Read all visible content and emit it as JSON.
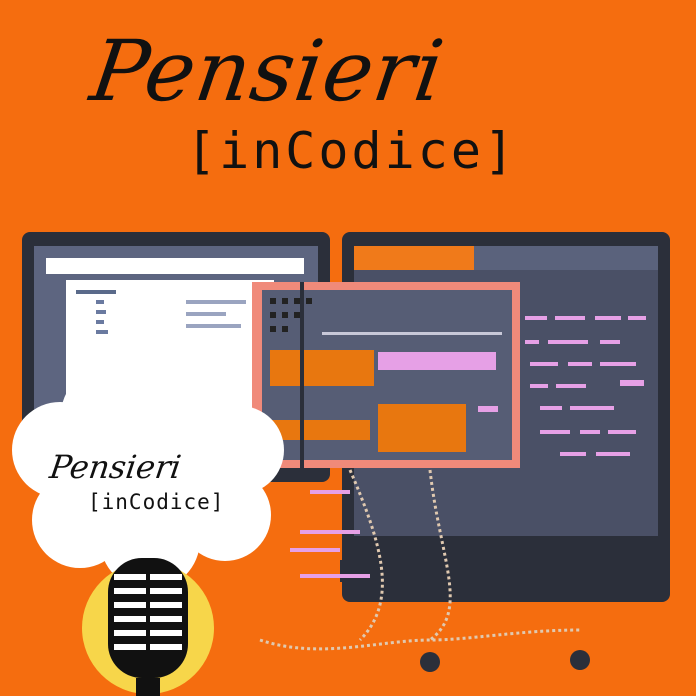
{
  "logo": {
    "script_text": "Pensieri",
    "mono_text": "[inCodice]"
  },
  "badge": {
    "script_text": "Pensieri",
    "mono_text": "[inCodice]"
  },
  "colors": {
    "background": "#f56d0f",
    "monitor_frame": "#2b2f3a",
    "screen_dark": "#4a5066",
    "code_pink": "#e6a0e6",
    "accent_orange": "#e8770f",
    "cloud": "#ffffff",
    "mic_yellow": "#f7d64a"
  },
  "icons": [
    "monitor-icon",
    "cloud-icon",
    "microphone-icon"
  ]
}
